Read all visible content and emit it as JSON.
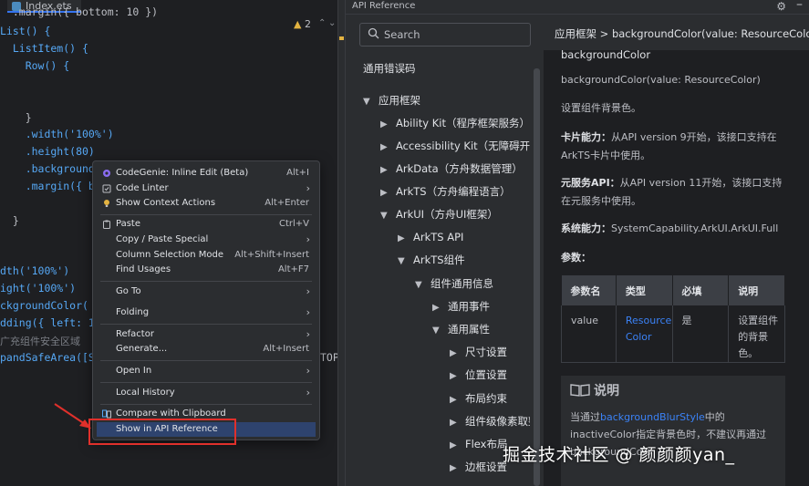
{
  "editor": {
    "tab_title": "Index.ets",
    "warning_count": "2",
    "lines": [
      "  .margin({ bottom: 10 })",
      "List() {",
      "  ListItem() {",
      "    Row() {",
      "",
      "",
      "    }",
      "    .width('100%')",
      "    .height(80)",
      "    .background(",
      "    .margin({ bo",
      "",
      "  }",
      "",
      "",
      "dth('100%')",
      "ight('100%')",
      "ckgroundColor(",
      "dding({ left: 1",
      "广充组件安全区域",
      "pandSafeArea([S"
    ],
    "overflow_text": "TOP,"
  },
  "context_menu": {
    "items": [
      {
        "label": "CodeGenie: Inline Edit (Beta)",
        "shortcut": "Alt+I",
        "icon": "codegenie-icon"
      },
      {
        "label": "Code Linter",
        "submenu": true,
        "icon": "linter-icon"
      },
      {
        "label": "Show Context Actions",
        "shortcut": "Alt+Enter",
        "icon": "bulb-icon"
      },
      {
        "label": "Paste",
        "shortcut": "Ctrl+V",
        "icon": "paste-icon"
      },
      {
        "label": "Copy / Paste Special",
        "submenu": true
      },
      {
        "label": "Column Selection Mode",
        "shortcut": "Alt+Shift+Insert"
      },
      {
        "label": "Find Usages",
        "shortcut": "Alt+F7"
      },
      {
        "label": "Go To",
        "submenu": true
      },
      {
        "label": "Folding",
        "submenu": true
      },
      {
        "label": "Refactor",
        "submenu": true
      },
      {
        "label": "Generate...",
        "shortcut": "Alt+Insert"
      },
      {
        "label": "Open In",
        "submenu": true
      },
      {
        "label": "Local History",
        "submenu": true
      },
      {
        "label": "Compare with Clipboard",
        "icon": "compare-icon"
      },
      {
        "label": "Show in API Reference",
        "selected": true
      }
    ],
    "submenu_arrow": "›"
  },
  "api_panel": {
    "title": "API Reference",
    "search_placeholder": "Search",
    "tree": [
      {
        "label": "通用错误码"
      },
      {
        "label": "应用框架",
        "expanded": true
      },
      {
        "label": "Ability Kit（程序框架服务）"
      },
      {
        "label": "Accessibility Kit（无障碍开发服务）"
      },
      {
        "label": "ArkData（方舟数据管理）"
      },
      {
        "label": "ArkTS（方舟编程语言）"
      },
      {
        "label": "ArkUI（方舟UI框架）",
        "expanded": true
      },
      {
        "label": "ArkTS API"
      },
      {
        "label": "ArkTS组件",
        "expanded": true
      },
      {
        "label": "组件通用信息",
        "expanded": true
      },
      {
        "label": "通用事件"
      },
      {
        "label": "通用属性",
        "expanded": true
      },
      {
        "label": "尺寸设置"
      },
      {
        "label": "位置设置"
      },
      {
        "label": "布局约束"
      },
      {
        "label": "组件级像素取整"
      },
      {
        "label": "Flex布局"
      },
      {
        "label": "边框设置"
      }
    ],
    "doc": {
      "breadcrumb": "应用框架 > backgroundColor(value: ResourceColor)",
      "heading": "backgroundColor",
      "signature": "backgroundColor(value: ResourceColor)",
      "description": "设置组件背景色。",
      "card_label": "卡片能力：",
      "card_text": "从API version 9开始，该接口支持在ArkTS卡片中使用。",
      "atomic_label": "元服务API：",
      "atomic_text": "从API version 11开始，该接口支持在元服务中使用。",
      "syscap_label": "系统能力：",
      "syscap_text": "SystemCapability.ArkUI.ArkUI.Full",
      "params_label": "参数：",
      "table": {
        "headers": [
          "参数名",
          "类型",
          "必填",
          "说明"
        ],
        "rows": [
          {
            "name": "value",
            "type": "ResourceColor",
            "required": "是",
            "desc": "设置组件的背景色。"
          }
        ]
      },
      "note_title": "说明",
      "note_pre": "当通过",
      "note_link": "backgroundBlurStyle",
      "note_post": "中的inactiveColor指定背景色时，不建议再通过backgroundColo"
    }
  },
  "watermark": "掘金技术社区 @ 颜颜颜yan_",
  "colors": {
    "accent": "#3574f0",
    "selection": "#2e436e",
    "link": "#3b82f6",
    "annotation": "#e0302b"
  }
}
